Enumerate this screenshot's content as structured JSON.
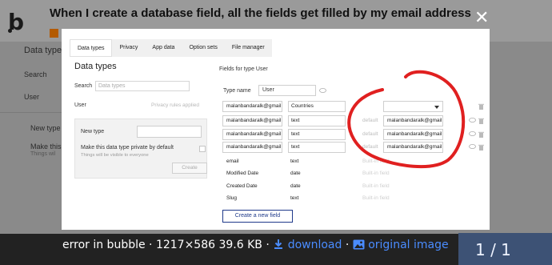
{
  "topic": {
    "title": "When I create a database field, all the fields get filled by my email address"
  },
  "background": {
    "labels": [
      "Data types",
      "Search",
      "User",
      "New type",
      "Make this d",
      "Things wil"
    ]
  },
  "caption": {
    "text": "error in bubble · 1217×586 39.6 KB ·",
    "download_label": "download",
    "separator": "·",
    "original_label": "original image",
    "link_color": "#4a8cff"
  },
  "pager": {
    "text": "1 / 1"
  },
  "modal": {
    "tabs": [
      {
        "label": "Data types",
        "active": true
      },
      {
        "label": "Privacy",
        "active": false
      },
      {
        "label": "App data",
        "active": false
      },
      {
        "label": "Option sets",
        "active": false
      },
      {
        "label": "File manager",
        "active": false
      }
    ],
    "left": {
      "title": "Data types",
      "search_label": "Search",
      "search_placeholder": "Data types",
      "user_label": "User",
      "privacy_note": "Privacy rules applied",
      "new_type_label": "New type",
      "private_label": "Make this data type private by default",
      "private_sub": "Things will be visible to everyone",
      "create_label": "Create"
    },
    "right": {
      "fields_title": "Fields for type User",
      "type_name_label": "Type name",
      "type_name_value": "User",
      "custom_fields": [
        {
          "name": "malanbandaralk@gmail",
          "type": "Countries",
          "default_kind": "dropdown",
          "default_value": ""
        },
        {
          "name": "malanbandaralk@gmail",
          "type": "text",
          "default_kind": "text",
          "default_label": "default",
          "default_value": "malanbandaralk@gmail"
        },
        {
          "name": "malanbandaralk@gmail",
          "type": "text",
          "default_kind": "text",
          "default_label": "default",
          "default_value": "malanbandaralk@gmail"
        },
        {
          "name": "malanbandaralk@gmail",
          "type": "text",
          "default_kind": "text",
          "default_label": "default",
          "default_value": "malanbandaralk@gmail"
        }
      ],
      "builtin_fields": [
        {
          "name": "email",
          "type": "text",
          "note": "Built-in field"
        },
        {
          "name": "Modified Date",
          "type": "date",
          "note": "Built-in field"
        },
        {
          "name": "Created Date",
          "type": "date",
          "note": "Built-in field"
        },
        {
          "name": "Slug",
          "type": "text",
          "note": "Built-in field"
        }
      ],
      "create_field_label": "Create a new field"
    }
  },
  "annotation": {
    "color": "#e02020"
  },
  "icons": [
    "close-icon",
    "download-icon",
    "image-icon",
    "comment-icon",
    "trash-icon",
    "chevron-down-icon"
  ]
}
